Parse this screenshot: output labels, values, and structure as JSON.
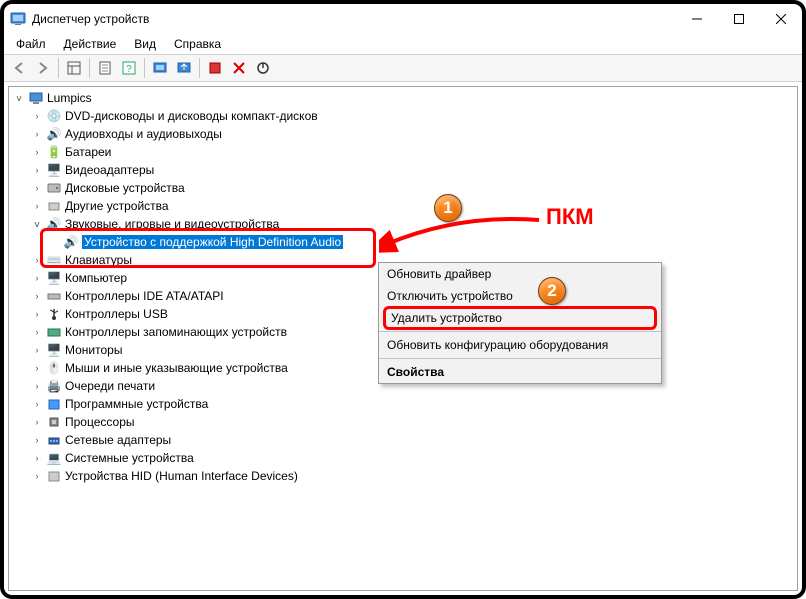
{
  "window": {
    "title": "Диспетчер устройств"
  },
  "menu": {
    "file": "Файл",
    "action": "Действие",
    "view": "Вид",
    "help": "Справка"
  },
  "tree": {
    "root": "Lumpics",
    "dvd": "DVD-дисководы и дисководы компакт-дисков",
    "audio_io": "Аудиовходы и аудиовыходы",
    "batteries": "Батареи",
    "video_adapters": "Видеоадаптеры",
    "disk_drives": "Дисковые устройства",
    "other": "Другие устройства",
    "sound": "Звуковые, игровые и видеоустройства",
    "hd_audio": "Устройство с поддержкой High Definition Audio",
    "keyboards": "Клавиатуры",
    "computer": "Компьютер",
    "ide": "Контроллеры IDE ATA/ATAPI",
    "usb": "Контроллеры USB",
    "storage_ctrl": "Контроллеры запоминающих устройств",
    "monitors": "Мониторы",
    "mice": "Мыши и иные указывающие устройства",
    "print_queues": "Очереди печати",
    "software_devices": "Программные устройства",
    "processors": "Процессоры",
    "net_adapters": "Сетевые адаптеры",
    "system_devices": "Системные устройства",
    "hid": "Устройства HID (Human Interface Devices)"
  },
  "context_menu": {
    "update_driver": "Обновить драйвер",
    "disable": "Отключить устройство",
    "uninstall": "Удалить устройство",
    "scan_hw": "Обновить конфигурацию оборудования",
    "properties": "Свойства"
  },
  "annotation": {
    "rmb": "ПКМ",
    "marker1": "1",
    "marker2": "2"
  }
}
